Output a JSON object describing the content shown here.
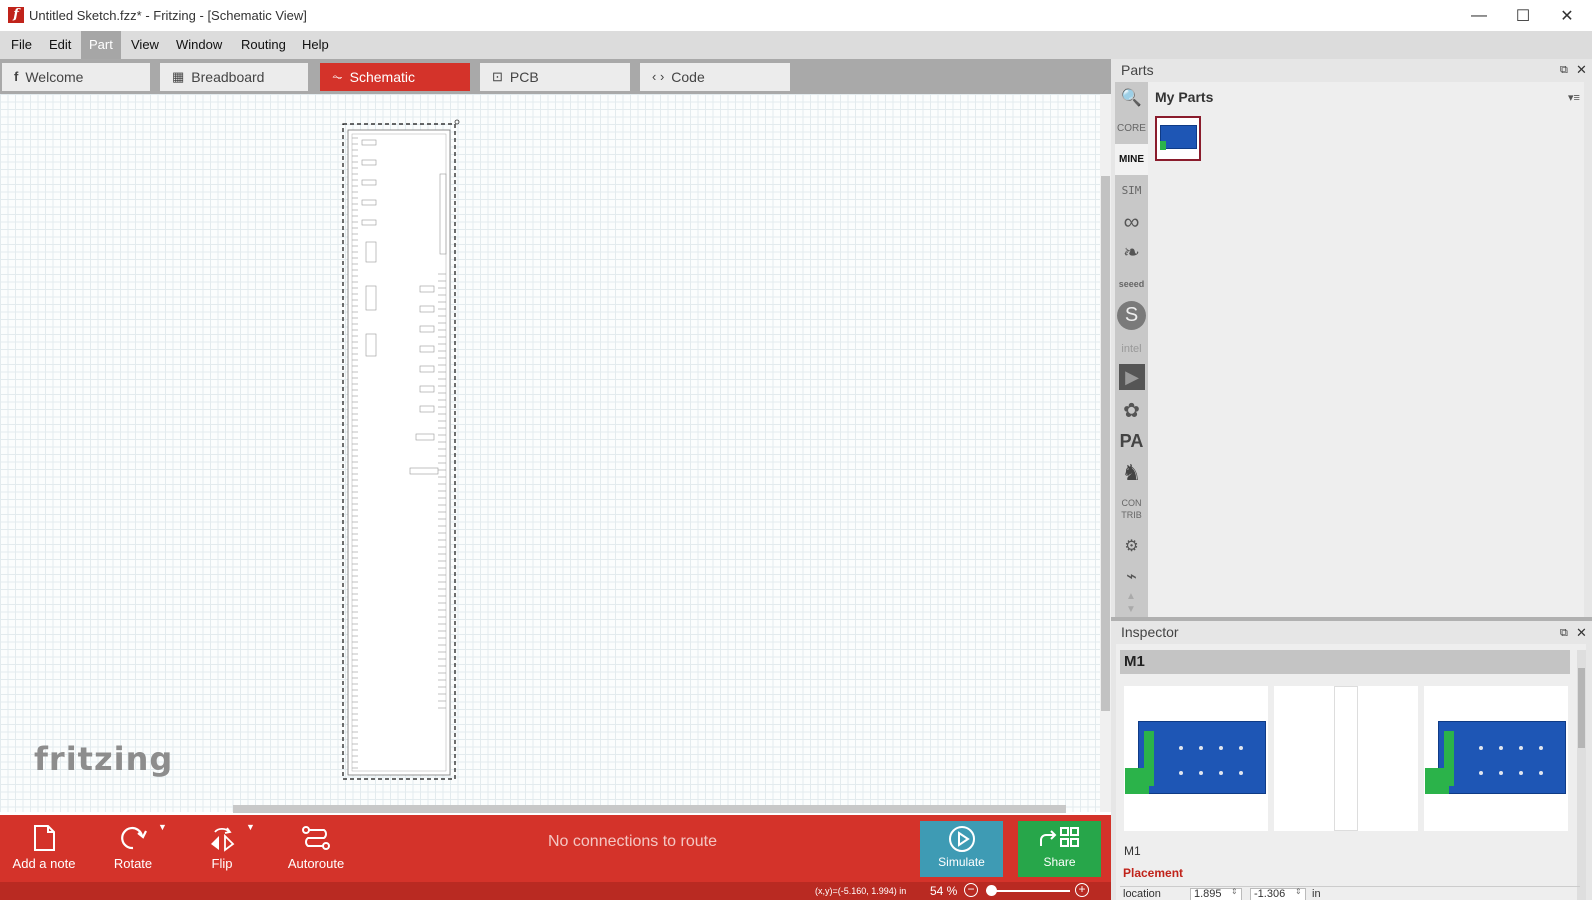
{
  "window": {
    "title": "Untitled Sketch.fzz* - Fritzing - [Schematic View]",
    "app_icon_glyph": "f",
    "minimize_glyph": "—",
    "maximize_glyph": "☐",
    "close_glyph": "✕"
  },
  "menu": [
    "File",
    "Edit",
    "Part",
    "View",
    "Window",
    "Routing",
    "Help"
  ],
  "menu_active": "Part",
  "tabs": [
    {
      "label": "Welcome",
      "icon": "fritzing-f-icon",
      "glyph": "f"
    },
    {
      "label": "Breadboard",
      "icon": "breadboard-icon",
      "glyph": "▦"
    },
    {
      "label": "Schematic",
      "icon": "schematic-icon",
      "glyph": "⏦"
    },
    {
      "label": "PCB",
      "icon": "pcb-icon",
      "glyph": "⊡"
    },
    {
      "label": "Code",
      "icon": "code-icon",
      "glyph": "‹ ›"
    }
  ],
  "active_tab": "Schematic",
  "canvas": {
    "logo": "fritzing"
  },
  "toolbar": {
    "add_note": "Add a note",
    "rotate": "Rotate",
    "flip": "Flip",
    "autoroute": "Autoroute",
    "route_status": "No connections to route",
    "simulate": "Simulate",
    "share": "Share"
  },
  "status": {
    "coords": "(x,y)=(-5.160, 1.994) in",
    "zoom": "54 %",
    "zoom_out": "−",
    "zoom_in": "+"
  },
  "parts": {
    "title": "Parts",
    "bins": [
      {
        "name": "search",
        "label": "🔍"
      },
      {
        "name": "core",
        "label": "CORE"
      },
      {
        "name": "mine",
        "label": "MINE"
      },
      {
        "name": "sim",
        "label": "SIM"
      },
      {
        "name": "arduino",
        "label": "∞"
      },
      {
        "name": "sparkfun",
        "label": "❧"
      },
      {
        "name": "seeed",
        "label": "seeed"
      },
      {
        "name": "snootlab",
        "label": "S"
      },
      {
        "name": "intel",
        "label": "intel"
      },
      {
        "name": "play",
        "label": "▶"
      },
      {
        "name": "adafruit",
        "label": "✿"
      },
      {
        "name": "pa",
        "label": "PA"
      },
      {
        "name": "animal",
        "label": "♞"
      },
      {
        "name": "contrib",
        "label": "CON TRIB"
      },
      {
        "name": "bin-a",
        "label": "⚙"
      },
      {
        "name": "bin-b",
        "label": "⌁"
      }
    ],
    "active_bin": "MINE",
    "section_title": "My Parts"
  },
  "inspector": {
    "title": "Inspector",
    "part_name": "M1",
    "part_label": "M1",
    "placement_heading": "Placement",
    "location_label": "location",
    "location_x": "1.895",
    "location_y": "-1.306",
    "location_unit": "in"
  },
  "colors": {
    "accent_red": "#d4332a",
    "simulate_blue": "#3e9bb4",
    "share_green": "#27a64a",
    "pcb_blue": "#1e56b5"
  }
}
